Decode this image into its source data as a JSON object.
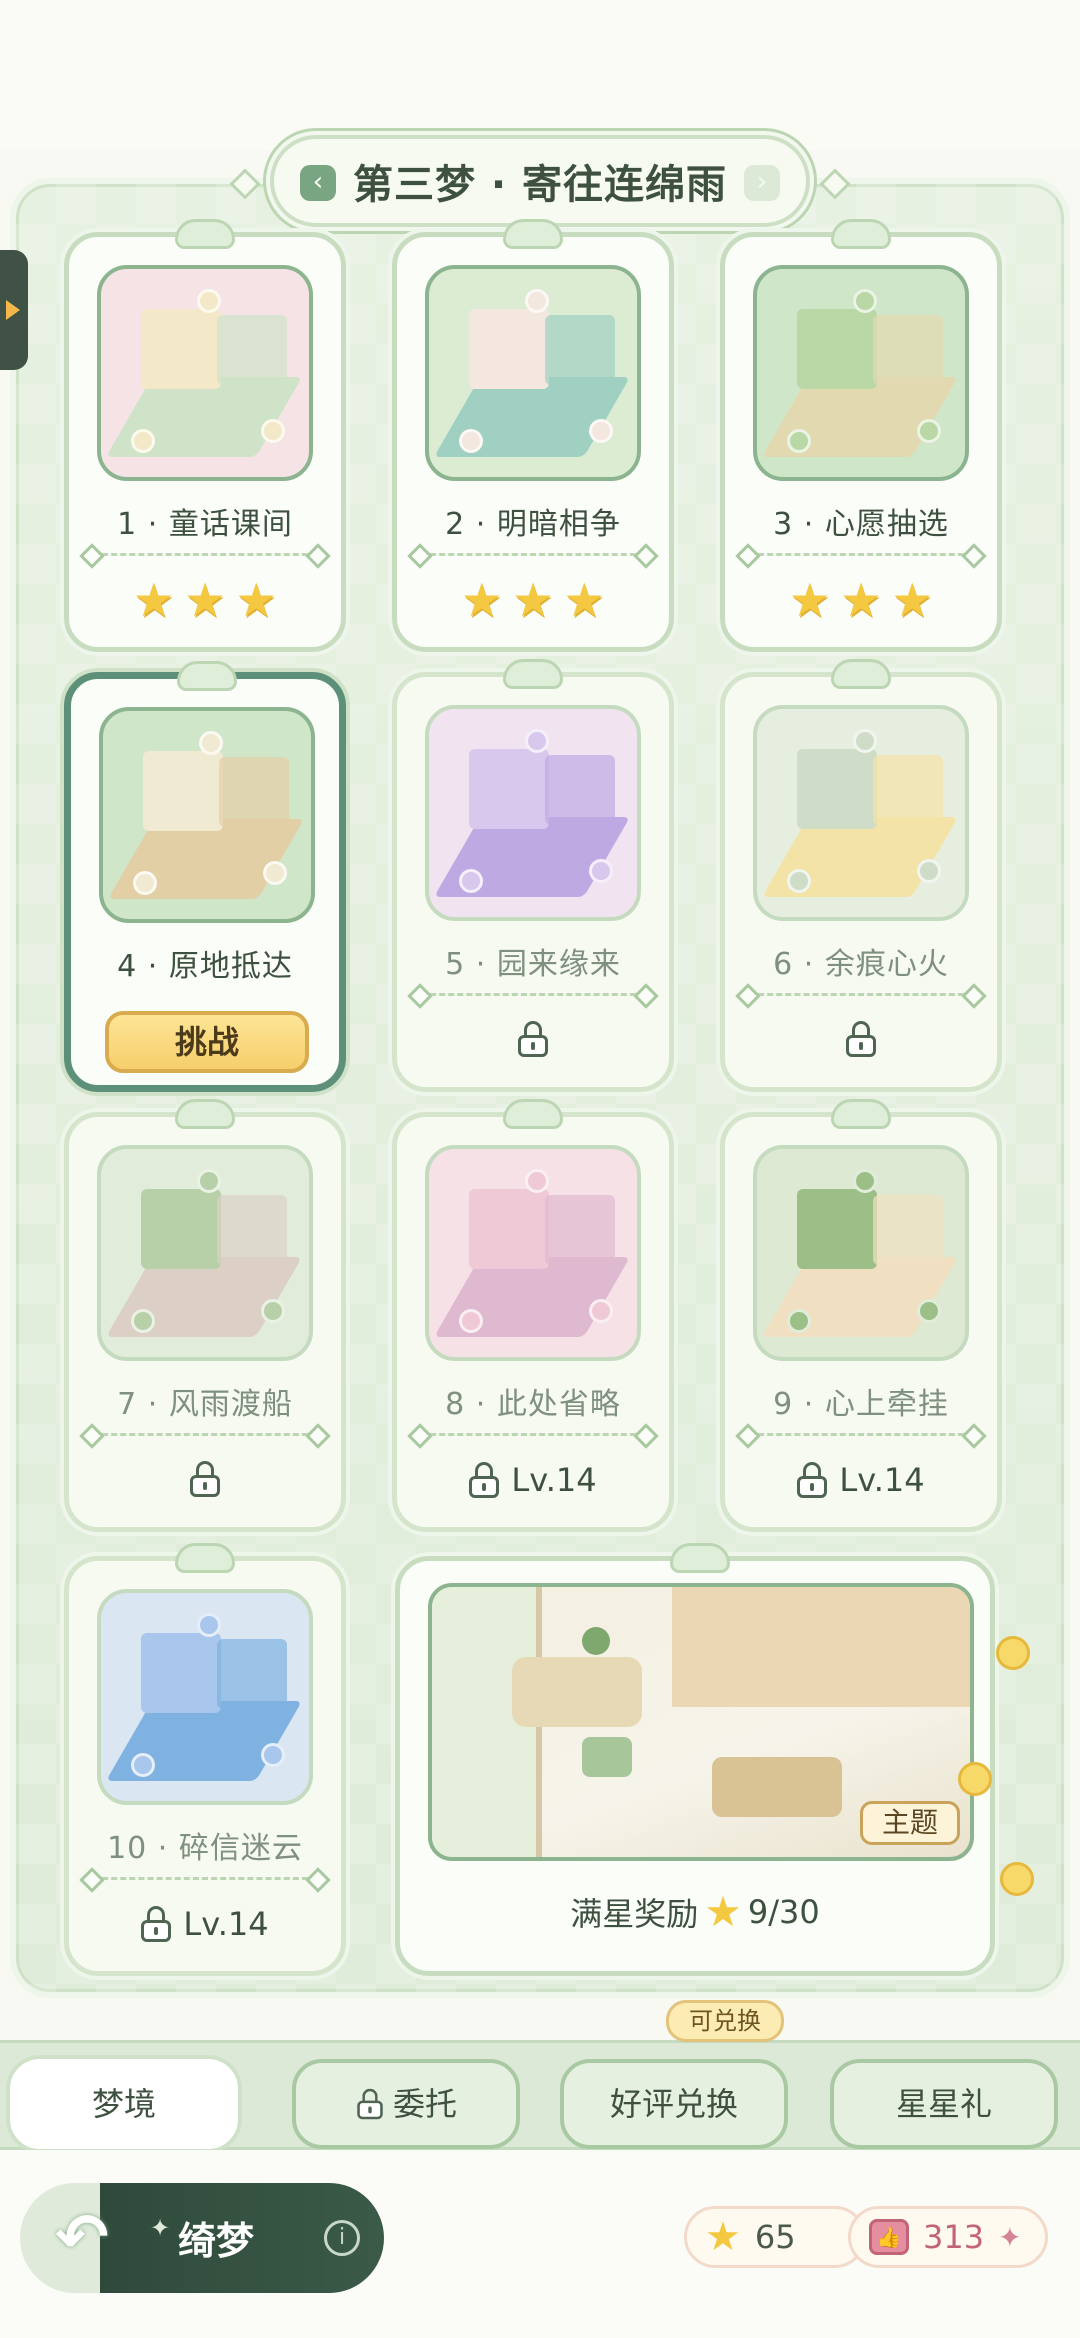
{
  "chapter_title": "第三梦 · 寄往连绵雨",
  "stages": [
    {
      "name": "1 · 童话课间",
      "status": "cleared",
      "stars": 3,
      "theme": [
        "#f6e3e6",
        "#f3e9c8",
        "#cfe3c8"
      ]
    },
    {
      "name": "2 · 明暗相争",
      "status": "cleared",
      "stars": 3,
      "theme": [
        "#dcecd3",
        "#f4e7df",
        "#9fd0c2"
      ]
    },
    {
      "name": "3 · 心愿抽选",
      "status": "cleared",
      "stars": 3,
      "theme": [
        "#cfe6c9",
        "#b9d8a6",
        "#e3d9b0"
      ]
    },
    {
      "name": "4 · 原地抵达",
      "status": "current",
      "button": "挑战",
      "theme": [
        "#cfe6c9",
        "#f1ead2",
        "#e3cfa6"
      ]
    },
    {
      "name": "5 · 园来缘来",
      "status": "locked",
      "lock_text": "",
      "theme": [
        "#f1e4f0",
        "#d9c8ee",
        "#bfa9e3"
      ]
    },
    {
      "name": "6 · 余痕心火",
      "status": "locked",
      "lock_text": "",
      "theme": [
        "#e6efdf",
        "#cfdcc8",
        "#f3e3a6"
      ]
    },
    {
      "name": "7 · 风雨渡船",
      "status": "locked",
      "lock_text": "",
      "theme": [
        "#e1edda",
        "#b8d0a8",
        "#dcd0c6"
      ]
    },
    {
      "name": "8 · 此处省略",
      "status": "locked",
      "lock_text": "Lv.14",
      "theme": [
        "#f6e1e6",
        "#efc9d6",
        "#dfb9cf"
      ]
    },
    {
      "name": "9 · 心上牵挂",
      "status": "locked",
      "lock_text": "Lv.14",
      "theme": [
        "#dde9d2",
        "#9cbf87",
        "#f1dfc1"
      ]
    },
    {
      "name": "10 · 碎信迷云",
      "status": "locked",
      "lock_text": "Lv.14",
      "theme": [
        "#dbe6f3",
        "#a9c6ec",
        "#7fb2e0"
      ]
    }
  ],
  "reward": {
    "label": "满星奖励",
    "progress": "9/30",
    "tag": "主题"
  },
  "tabs": [
    {
      "label": "梦境",
      "active": true,
      "locked": false
    },
    {
      "label": "委托",
      "active": false,
      "locked": true
    },
    {
      "label": "好评兑换",
      "active": false,
      "locked": false
    },
    {
      "label": "星星礼",
      "active": false,
      "locked": false
    }
  ],
  "tab_badge": "可兑换",
  "mode_name": "绮梦",
  "currency": {
    "stars": "65",
    "likes": "313"
  },
  "colors": {
    "accent_green": "#5d9078",
    "star_gold": "#f5c842",
    "button_gold": "#f6cf6b",
    "like_pink": "#c26478"
  }
}
